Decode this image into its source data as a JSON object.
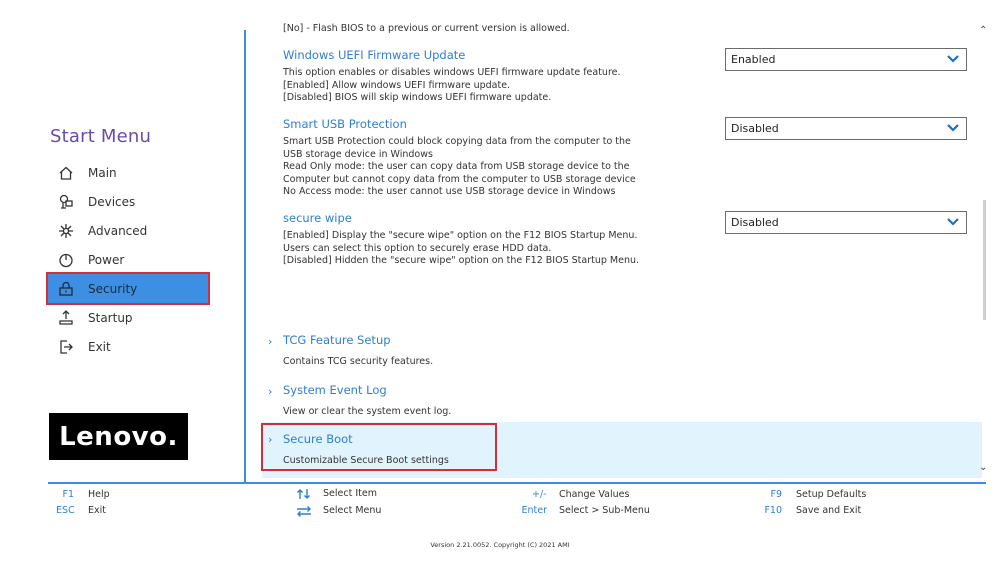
{
  "sidebar": {
    "title": "Start Menu",
    "items": [
      {
        "label": "Main",
        "icon": "home-icon"
      },
      {
        "label": "Devices",
        "icon": "devices-icon"
      },
      {
        "label": "Advanced",
        "icon": "advanced-icon"
      },
      {
        "label": "Power",
        "icon": "power-icon"
      },
      {
        "label": "Security",
        "icon": "lock-icon"
      },
      {
        "label": "Startup",
        "icon": "startup-icon"
      },
      {
        "label": "Exit",
        "icon": "exit-icon"
      }
    ],
    "active": "Security",
    "logo": "Lenovo."
  },
  "main": {
    "clipped_text": "[No] - Flash BIOS to a previous  or current version is allowed.",
    "settings": [
      {
        "title": "Windows UEFI Firmware Update",
        "desc": "This option enables or disables windows UEFI firmware  update feature.\n[Enabled] Allow windows UEFI firmware update.\n[Disabled] BIOS will skip windows UEFI firmware update.",
        "value": "Enabled"
      },
      {
        "title": "Smart USB Protection",
        "desc": "Smart USB Protection could block copying data from the computer to the\nUSB storage device in Windows\nRead Only mode: the user can copy data from USB storage device to the\nComputer but cannot copy data from the computer to USB storage device\nNo Access mode: the user cannot use USB storage device in Windows",
        "value": "Disabled"
      },
      {
        "title": "secure wipe",
        "desc": "[Enabled] Display the \"secure wipe\" option on the  F12 BIOS Startup Menu.\nUsers can select this option to securely erase HDD data.\n[Disabled] Hidden the \"secure wipe\" option on the F12 BIOS Startup Menu.",
        "value": "Disabled"
      }
    ],
    "submenus": [
      {
        "title": "TCG Feature Setup",
        "desc": "Contains TCG security features."
      },
      {
        "title": "System Event Log",
        "desc": "View or clear the system event log."
      },
      {
        "title": "Secure Boot",
        "desc": "Customizable Secure Boot settings"
      }
    ]
  },
  "footer": {
    "f1_key": "F1",
    "f1_label": "Help",
    "esc_key": "ESC",
    "esc_label": "Exit",
    "select_item": "Select Item",
    "select_menu": "Select Menu",
    "change_key": "+/-",
    "change_label": "Change Values",
    "enter_key": "Enter",
    "enter_label": "Select > Sub-Menu",
    "f9_key": "F9",
    "f9_label": "Setup Defaults",
    "f10_key": "F10",
    "f10_label": "Save and Exit"
  },
  "version": "Version 2.21.0052. Copyright (C) 2021 AMI",
  "colors": {
    "accent": "#2f7fcf",
    "active_bg": "#3d8fe4",
    "highlight_bg": "#e1f3fc",
    "annotation_red": "#d32f3a",
    "title_purple": "#6a4aa8"
  }
}
